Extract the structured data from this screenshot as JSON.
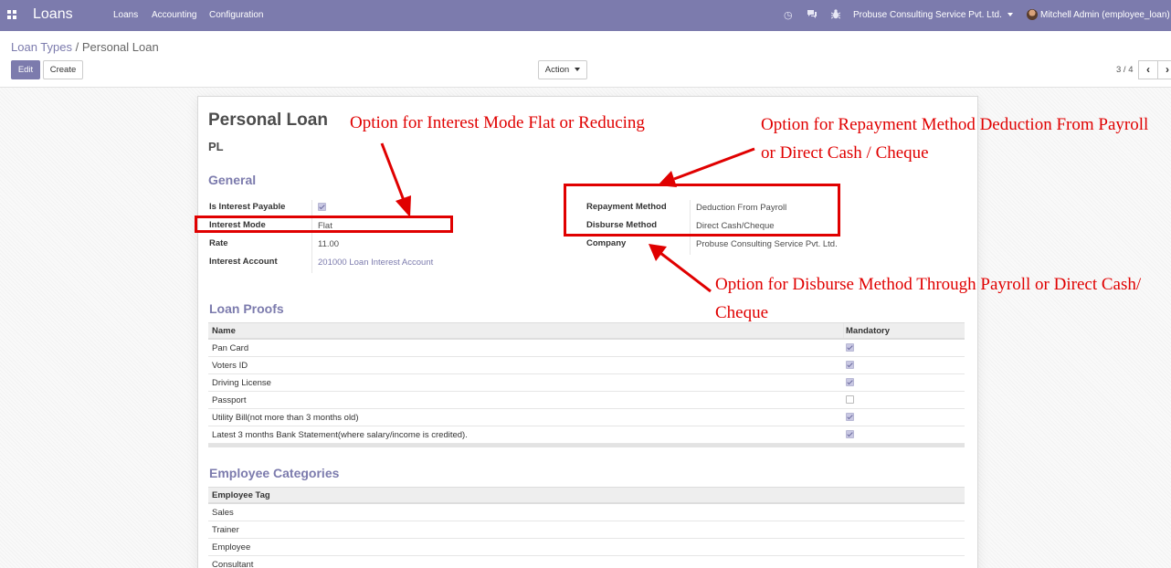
{
  "navbar": {
    "brand": "Loans",
    "menus": [
      "Loans",
      "Accounting",
      "Configuration"
    ],
    "company": "Probuse Consulting Service Pvt. Ltd.",
    "user": "Mitchell Admin (employee_loan)"
  },
  "breadcrumb": {
    "parent": "Loan Types",
    "separator": "/",
    "current": "Personal Loan"
  },
  "controls": {
    "edit": "Edit",
    "create": "Create",
    "action": "Action",
    "pager": "3 / 4"
  },
  "record": {
    "name": "Personal Loan",
    "code": "PL",
    "general_title": "General",
    "left_fields": [
      {
        "label": "Is Interest Payable",
        "checked": true
      },
      {
        "label": "Interest Mode",
        "value": "Flat"
      },
      {
        "label": "Rate",
        "value": "11.00"
      },
      {
        "label": "Interest Account",
        "value": "201000 Loan Interest Account"
      }
    ],
    "right_fields": [
      {
        "label": "Repayment Method",
        "value": "Deduction From Payroll"
      },
      {
        "label": "Disburse Method",
        "value": "Direct Cash/Cheque"
      },
      {
        "label": "Company",
        "value": "Probuse Consulting Service Pvt. Ltd."
      }
    ]
  },
  "proofs": {
    "title": "Loan Proofs",
    "columns": [
      "Name",
      "Mandatory"
    ],
    "rows": [
      {
        "name": "Pan Card",
        "mandatory": true
      },
      {
        "name": "Voters ID",
        "mandatory": true
      },
      {
        "name": "Driving License",
        "mandatory": true
      },
      {
        "name": "Passport",
        "mandatory": false
      },
      {
        "name": "Utility Bill(not more than 3 months old)",
        "mandatory": true
      },
      {
        "name": "Latest 3 months Bank Statement(where salary/income is credited).",
        "mandatory": true
      }
    ]
  },
  "categories": {
    "title": "Employee Categories",
    "column": "Employee Tag",
    "rows": [
      "Sales",
      "Trainer",
      "Employee",
      "Consultant"
    ]
  },
  "annotations": {
    "interest": "Option for Interest Mode  Flat or Reducing",
    "repayment_line1": "Option for Repayment Method Deduction From Payroll",
    "repayment_line2": "or Direct Cash / Cheque",
    "disburse_line1": "Option for Disburse Method Through Payroll or Direct Cash/",
    "disburse_line2": "Cheque",
    "color": "#e00000"
  },
  "colors": {
    "brand": "#7c7bad",
    "annotation": "#e00000"
  }
}
